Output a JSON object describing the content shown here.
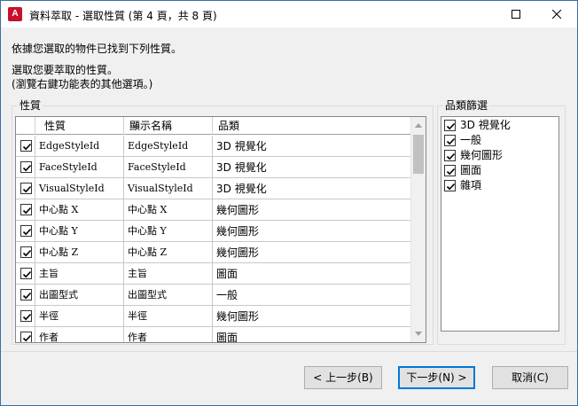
{
  "window": {
    "title": "資料萃取 - 選取性質 (第 4 頁，共 8 頁)",
    "app_icon_letter": "A",
    "brand_color": "#c8102e"
  },
  "instructions": {
    "line1": "依據您選取的物件已找到下列性質。",
    "line2": "選取您要萃取的性質。",
    "line3": "(瀏覽右鍵功能表的其他選項。)"
  },
  "properties": {
    "group_label": "性質",
    "columns": [
      "性質",
      "顯示名稱",
      "品類"
    ],
    "rows": [
      {
        "checked": true,
        "property": "EdgeStyleId",
        "display_name": "EdgeStyleId",
        "category": "3D 視覺化"
      },
      {
        "checked": true,
        "property": "FaceStyleId",
        "display_name": "FaceStyleId",
        "category": "3D 視覺化"
      },
      {
        "checked": true,
        "property": "VisualStyleId",
        "display_name": "VisualStyleId",
        "category": "3D 視覺化"
      },
      {
        "checked": true,
        "property": "中心點 X",
        "display_name": "中心點 X",
        "category": "幾何圖形"
      },
      {
        "checked": true,
        "property": "中心點 Y",
        "display_name": "中心點 Y",
        "category": "幾何圖形"
      },
      {
        "checked": true,
        "property": "中心點 Z",
        "display_name": "中心點 Z",
        "category": "幾何圖形"
      },
      {
        "checked": true,
        "property": "主旨",
        "display_name": "主旨",
        "category": "圖面"
      },
      {
        "checked": true,
        "property": "出圖型式",
        "display_name": "出圖型式",
        "category": "一般"
      },
      {
        "checked": true,
        "property": "半徑",
        "display_name": "半徑",
        "category": "幾何圖形"
      },
      {
        "checked": true,
        "property": "作者",
        "display_name": "作者",
        "category": "圖面"
      }
    ]
  },
  "category_filter": {
    "group_label": "品類篩選",
    "items": [
      {
        "checked": true,
        "label": "3D 視覺化"
      },
      {
        "checked": true,
        "label": "一般"
      },
      {
        "checked": true,
        "label": "幾何圖形"
      },
      {
        "checked": true,
        "label": "圖面"
      },
      {
        "checked": true,
        "label": "雜項"
      }
    ]
  },
  "buttons": {
    "back": "< 上一步(B)",
    "next": "下一步(N) >",
    "cancel": "取消(C)"
  }
}
